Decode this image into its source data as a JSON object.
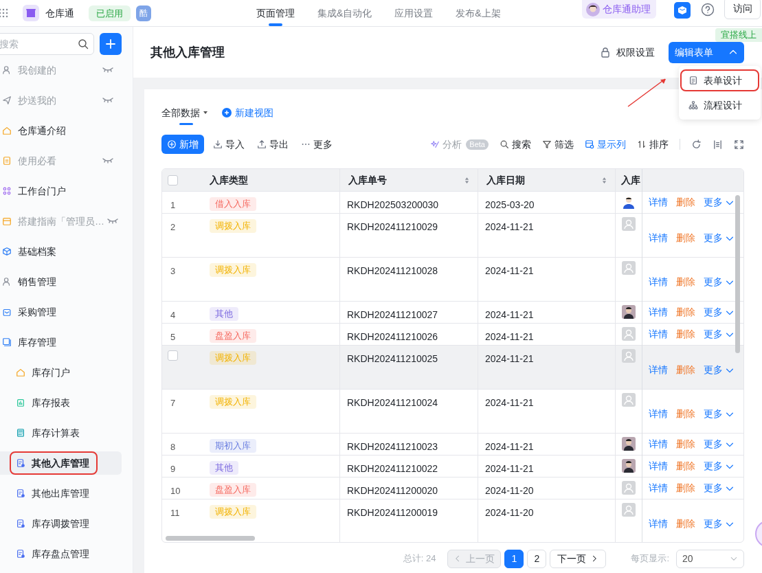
{
  "app": {
    "name": "仓库通",
    "status": "已启用",
    "badge": "酷"
  },
  "top_tabs": [
    {
      "label": "页面管理",
      "selected": true
    },
    {
      "label": "集成&自动化",
      "selected": false
    },
    {
      "label": "应用设置",
      "selected": false
    },
    {
      "label": "发布&上架",
      "selected": false
    }
  ],
  "assistant": "仓库通助理",
  "visit_button": "访问",
  "env_tag": "宜搭线上",
  "sidebar": {
    "search_placeholder": "搜索",
    "items": [
      {
        "label": "我创建的",
        "hidden": true,
        "selected": false,
        "highlighted": false
      },
      {
        "label": "抄送我的",
        "hidden": true,
        "selected": false,
        "highlighted": false
      },
      {
        "label": "仓库通介绍",
        "hidden": false,
        "selected": false,
        "highlighted": false
      },
      {
        "label": "使用必看",
        "hidden": true,
        "selected": false,
        "highlighted": false
      },
      {
        "label": "工作台门户",
        "hidden": false,
        "selected": false,
        "highlighted": false
      },
      {
        "label": "搭建指南「管理员…",
        "hidden": true,
        "selected": false,
        "highlighted": false
      },
      {
        "label": "基础档案",
        "hidden": false,
        "selected": false,
        "highlighted": false
      },
      {
        "label": "销售管理",
        "hidden": false,
        "selected": false,
        "highlighted": false
      },
      {
        "label": "采购管理",
        "hidden": false,
        "selected": false,
        "highlighted": false
      },
      {
        "label": "库存管理",
        "hidden": false,
        "selected": false,
        "highlighted": false,
        "children": [
          {
            "label": "库存门户",
            "hidden": false,
            "selected": false,
            "highlighted": false
          },
          {
            "label": "库存报表",
            "hidden": false,
            "selected": false,
            "highlighted": false
          },
          {
            "label": "库存计算表",
            "hidden": false,
            "selected": false,
            "highlighted": false
          },
          {
            "label": "其他入库管理",
            "hidden": false,
            "selected": true,
            "highlighted": true
          },
          {
            "label": "其他出库管理",
            "hidden": false,
            "selected": false,
            "highlighted": false
          },
          {
            "label": "库存调拨管理",
            "hidden": false,
            "selected": false,
            "highlighted": false
          },
          {
            "label": "库存盘点管理",
            "hidden": false,
            "selected": false,
            "highlighted": false
          }
        ]
      }
    ]
  },
  "page": {
    "title": "其他入库管理",
    "permission_button": "权限设置",
    "edit_button": "编辑表单",
    "edit_menu": {
      "expanded": true,
      "items": [
        {
          "label": "表单设计",
          "highlighted": true
        },
        {
          "label": "流程设计",
          "highlighted": false
        }
      ]
    }
  },
  "views": [
    {
      "label": "全部数据",
      "selected": true
    }
  ],
  "new_view": "新建视图",
  "toolbar_left": [
    {
      "label": "新增",
      "kind": "primary"
    },
    {
      "label": "导入",
      "kind": "plain"
    },
    {
      "label": "导出",
      "kind": "plain"
    },
    {
      "label": "更多",
      "kind": "plain"
    }
  ],
  "toolbar_right": [
    {
      "label": "分析",
      "badge": "Beta",
      "disabled": true,
      "active": false
    },
    {
      "label": "搜索",
      "disabled": false,
      "active": false
    },
    {
      "label": "筛选",
      "disabled": false,
      "active": false
    },
    {
      "label": "显示列",
      "disabled": false,
      "active": true
    },
    {
      "label": "排序",
      "disabled": false,
      "active": false
    }
  ],
  "table": {
    "select_all": {
      "checked": false
    },
    "columns": [
      {
        "label": "入库类型",
        "sortable": false
      },
      {
        "label": "入库单号",
        "sortable": true
      },
      {
        "label": "入库日期",
        "sortable": true
      },
      {
        "label": "入库"
      }
    ],
    "rows": [
      {
        "index": "1",
        "type": "借入入库",
        "color": "#f5695f",
        "number": "RKDH202503200030",
        "date": "2025-03-20",
        "avatar": {
          "kind": "figure"
        },
        "tall": false,
        "hovered": false,
        "actions": [
          {
            "label": "详情",
            "kind": "link"
          },
          {
            "label": "删除",
            "kind": "danger"
          },
          {
            "label": "更多",
            "kind": "menu"
          }
        ]
      },
      {
        "index": "2",
        "type": "调拨入库",
        "color": "#f2b200",
        "number": "RKDH202411210029",
        "date": "2024-11-21",
        "avatar": {
          "kind": "default"
        },
        "tall": true,
        "hovered": false,
        "actions": [
          {
            "label": "详情",
            "kind": "link"
          },
          {
            "label": "删除",
            "kind": "danger"
          },
          {
            "label": "更多",
            "kind": "menu"
          }
        ]
      },
      {
        "index": "3",
        "type": "调拨入库",
        "color": "#f2b200",
        "number": "RKDH202411210028",
        "date": "2024-11-21",
        "avatar": {
          "kind": "default"
        },
        "tall": true,
        "hovered": false,
        "actions": [
          {
            "label": "详情",
            "kind": "link"
          },
          {
            "label": "删除",
            "kind": "danger"
          },
          {
            "label": "更多",
            "kind": "menu"
          }
        ]
      },
      {
        "index": "4",
        "type": "其他",
        "color": "#7d6be0",
        "number": "RKDH202411210027",
        "date": "2024-11-21",
        "avatar": {
          "kind": "photo"
        },
        "tall": false,
        "hovered": false,
        "actions": [
          {
            "label": "详情",
            "kind": "link"
          },
          {
            "label": "删除",
            "kind": "danger"
          },
          {
            "label": "更多",
            "kind": "menu"
          }
        ]
      },
      {
        "index": "5",
        "type": "盘盈入库",
        "color": "#f5695f",
        "number": "RKDH202411210026",
        "date": "2024-11-21",
        "avatar": {
          "kind": "default"
        },
        "tall": false,
        "hovered": false,
        "actions": [
          {
            "label": "详情",
            "kind": "link"
          },
          {
            "label": "删除",
            "kind": "danger"
          },
          {
            "label": "更多",
            "kind": "menu"
          }
        ]
      },
      {
        "type": "调拨入库",
        "color": "#f2b200",
        "number": "RKDH202411210025",
        "date": "2024-11-21",
        "avatar": {
          "kind": "default"
        },
        "tall": true,
        "hovered": true,
        "checked": false,
        "actions": [
          {
            "label": "详情",
            "kind": "link"
          },
          {
            "label": "删除",
            "kind": "danger"
          },
          {
            "label": "更多",
            "kind": "menu"
          }
        ]
      },
      {
        "index": "7",
        "type": "调拨入库",
        "color": "#f2b200",
        "number": "RKDH202411210024",
        "date": "2024-11-21",
        "avatar": {
          "kind": "default"
        },
        "tall": true,
        "hovered": false,
        "actions": [
          {
            "label": "详情",
            "kind": "link"
          },
          {
            "label": "删除",
            "kind": "danger"
          },
          {
            "label": "更多",
            "kind": "menu"
          }
        ]
      },
      {
        "index": "8",
        "type": "期初入库",
        "color": "#6b7fe0",
        "number": "RKDH202411210023",
        "date": "2024-11-21",
        "avatar": {
          "kind": "photo"
        },
        "tall": false,
        "hovered": false,
        "actions": [
          {
            "label": "详情",
            "kind": "link"
          },
          {
            "label": "删除",
            "kind": "danger"
          },
          {
            "label": "更多",
            "kind": "menu"
          }
        ]
      },
      {
        "index": "9",
        "type": "其他",
        "color": "#7d6be0",
        "number": "RKDH202411210022",
        "date": "2024-11-21",
        "avatar": {
          "kind": "photo"
        },
        "tall": false,
        "hovered": false,
        "actions": [
          {
            "label": "详情",
            "kind": "link"
          },
          {
            "label": "删除",
            "kind": "danger"
          },
          {
            "label": "更多",
            "kind": "menu"
          }
        ]
      },
      {
        "index": "10",
        "type": "盘盈入库",
        "color": "#f5695f",
        "number": "RKDH202411200020",
        "date": "2024-11-20",
        "avatar": {
          "kind": "default"
        },
        "tall": false,
        "hovered": false,
        "actions": [
          {
            "label": "详情",
            "kind": "link"
          },
          {
            "label": "删除",
            "kind": "danger"
          },
          {
            "label": "更多",
            "kind": "menu"
          }
        ]
      },
      {
        "index": "11",
        "type": "调拨入库",
        "color": "#f2b200",
        "number": "RKDH202411200019",
        "date": "2024-11-20",
        "avatar": {
          "kind": "default"
        },
        "tall": true,
        "hovered": false,
        "actions": [
          {
            "label": "详情",
            "kind": "link"
          },
          {
            "label": "删除",
            "kind": "danger"
          },
          {
            "label": "更多",
            "kind": "menu"
          }
        ]
      }
    ]
  },
  "pagination": {
    "total": "总计: 24",
    "prev": {
      "label": "上一页",
      "disabled": true
    },
    "pages": [
      {
        "label": "1",
        "selected": true
      },
      {
        "label": "2",
        "selected": false
      }
    ],
    "next": {
      "label": "下一页",
      "disabled": false
    },
    "page_size_label": "每页显示:",
    "page_size": "20"
  }
}
